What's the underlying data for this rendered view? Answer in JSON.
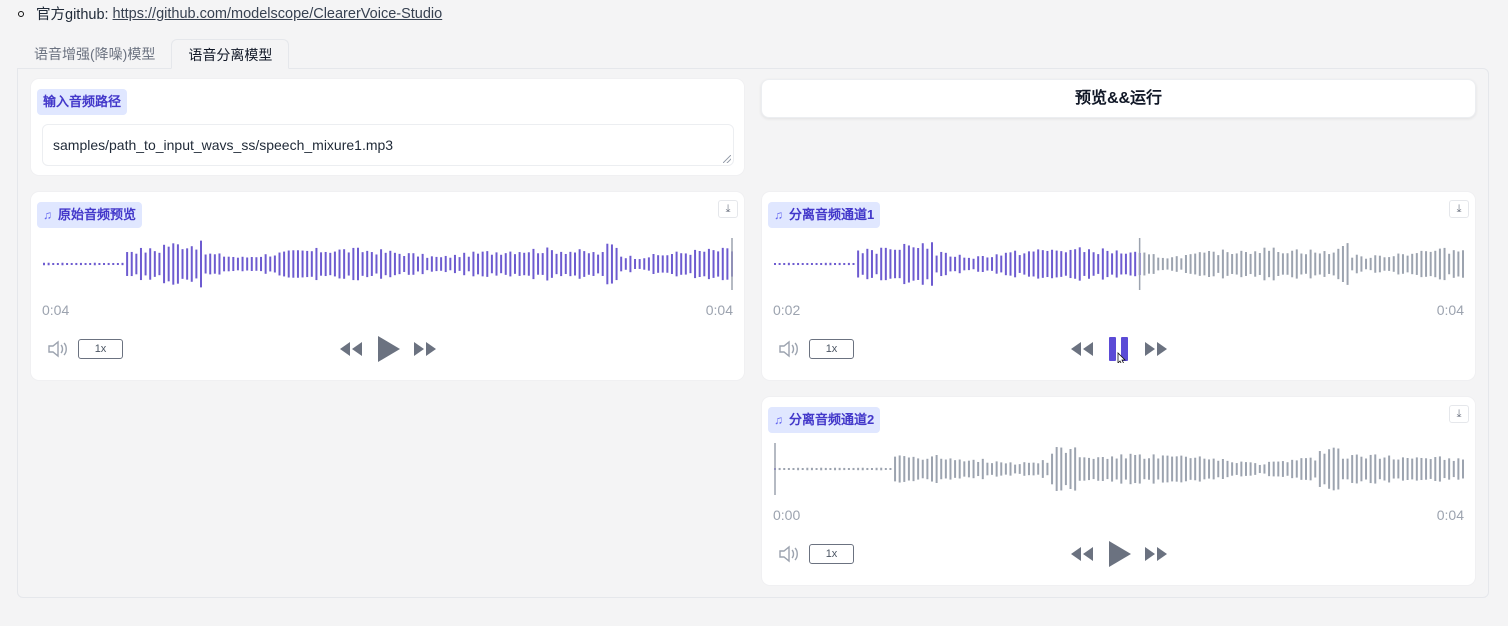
{
  "github": {
    "label": "官方github:",
    "link": "https://github.com/modelscope/ClearerVoice-Studio"
  },
  "tabs": [
    {
      "label": "语音增强(降噪)模型",
      "active": false
    },
    {
      "label": "语音分离模型",
      "active": true
    }
  ],
  "input": {
    "label": "输入音频路径",
    "value": "samples/path_to_input_wavs_ss/speech_mixure1.mp3"
  },
  "run_button": {
    "label": "预览&&运行"
  },
  "players": {
    "original": {
      "label": "原始音频预览",
      "time_current": "0:04",
      "time_total": "0:04",
      "speed": "1x",
      "played_fraction": 1.0,
      "playing": false
    },
    "channel1": {
      "label": "分离音频通道1",
      "time_current": "0:02",
      "time_total": "0:04",
      "speed": "1x",
      "played_fraction": 0.53,
      "playing": true
    },
    "channel2": {
      "label": "分离音频通道2",
      "time_current": "0:00",
      "time_total": "0:04",
      "speed": "1x",
      "played_fraction": 0.0,
      "playing": false
    }
  },
  "icons": {
    "bullet": "circle-bullet-icon",
    "music": "music-note-icon",
    "download": "download-icon",
    "volume": "volume-icon",
    "rewind": "rewind-icon",
    "play": "play-icon",
    "pause": "pause-icon",
    "forward": "fast-forward-icon"
  },
  "colors": {
    "played": "#6d5bd0",
    "unplayed": "#9ca3af",
    "accent_chip": "#e0e7ff",
    "pause_accent": "#5b4bd6"
  }
}
